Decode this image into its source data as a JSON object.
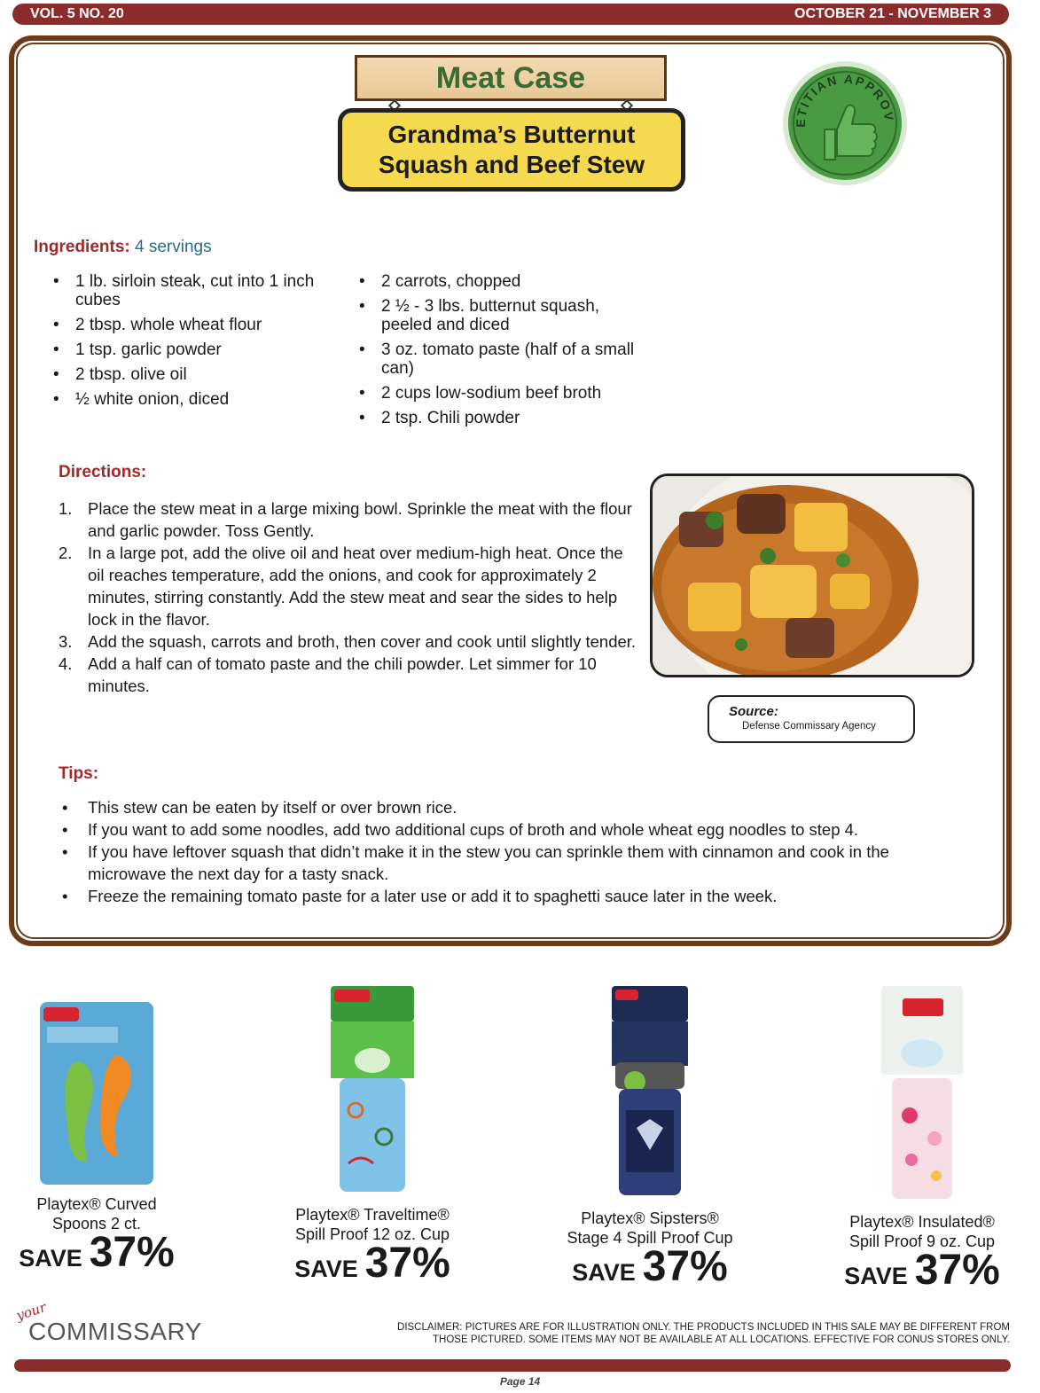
{
  "header": {
    "volume": "VOL. 5 NO. 20",
    "dates": "OCTOBER 21 - NOVEMBER 3"
  },
  "recipe": {
    "section_sign": "Meat Case",
    "title_line1": "Grandma’s Butternut",
    "title_line2": "Squash and Beef Stew",
    "badge_text": "DIETITIAN APPROVED",
    "ingredients_label": "Ingredients:",
    "servings": "4 servings",
    "ingredients_left": [
      "1 lb. sirloin steak, cut into 1 inch cubes",
      "2 tbsp. whole wheat flour",
      "1 tsp. garlic powder",
      "2 tbsp. olive oil",
      "½ white onion, diced"
    ],
    "ingredients_right": [
      "2 carrots, chopped",
      "2 ½ - 3 lbs. butternut squash, peeled and diced",
      "3 oz. tomato paste (half of a small can)",
      "2 cups low-sodium beef broth",
      "2 tsp. Chili powder"
    ],
    "directions_label": "Directions:",
    "directions": [
      {
        "num": "1.",
        "text": "Place the stew meat in a large mixing bowl.  Sprinkle the meat with the flour and garlic powder.  Toss Gently."
      },
      {
        "num": "2.",
        "text": "In a large pot, add the olive oil and heat over medium-high heat. Once the oil reaches temperature, add the onions, and cook for approximately 2 minutes, stirring constantly.  Add the stew meat and sear the sides to help lock in the flavor."
      },
      {
        "num": "3.",
        "text": "Add the squash, carrots and broth, then cover and cook until slightly tender."
      },
      {
        "num": "4.",
        "text": "Add a half can of tomato paste and the chili powder.  Let simmer for 10 minutes."
      }
    ],
    "source_label": "Source:",
    "source_value": "Defense Commissary Agency",
    "tips_label": "Tips:",
    "tips": [
      "This stew can be eaten by itself or over brown rice.",
      "If you want to add some noodles, add two additional cups of broth and whole wheat egg noodles to step 4.",
      "If you have leftover squash that didn’t make it in the stew you can sprinkle them with cinnamon and cook in the microwave the next day for a tasty snack.",
      "Freeze the remaining tomato paste for a later use or add it to spaghetti sauce later in the week."
    ]
  },
  "products": [
    {
      "line1": "Playtex® Curved",
      "line2": "Spoons 2 ct.",
      "save_word": "SAVE",
      "save_pct": "37%"
    },
    {
      "line1": "Playtex® Traveltime®",
      "line2": "Spill Proof 12 oz. Cup",
      "save_word": "SAVE",
      "save_pct": "37%"
    },
    {
      "line1": "Playtex® Sipsters®",
      "line2": "Stage 4 Spill Proof Cup",
      "save_word": "SAVE",
      "save_pct": "37%"
    },
    {
      "line1": "Playtex® Insulated®",
      "line2": "Spill Proof 9 oz. Cup",
      "save_word": "SAVE",
      "save_pct": "37%"
    }
  ],
  "footer": {
    "logo_your": "your",
    "logo_brand": "COMMISSARY",
    "disclaimer": "DISCLAIMER: PICTURES ARE FOR ILLUSTRATION ONLY. THE PRODUCTS INCLUDED IN THIS SALE MAY BE DIFFERENT FROM THOSE PICTURED. SOME ITEMS MAY NOT BE AVAILABLE AT ALL LOCATIONS. EFFECTIVE FOR CONUS STORES ONLY.",
    "page": "Page 14"
  },
  "colors": {
    "header_bar": "#8a2d2b",
    "frame_brown": "#6e3b19",
    "section_red": "#a02a2a",
    "servings_blue": "#2e6a8e",
    "title_yellow": "#f5d94e",
    "badge_green": "#4a9a44"
  }
}
